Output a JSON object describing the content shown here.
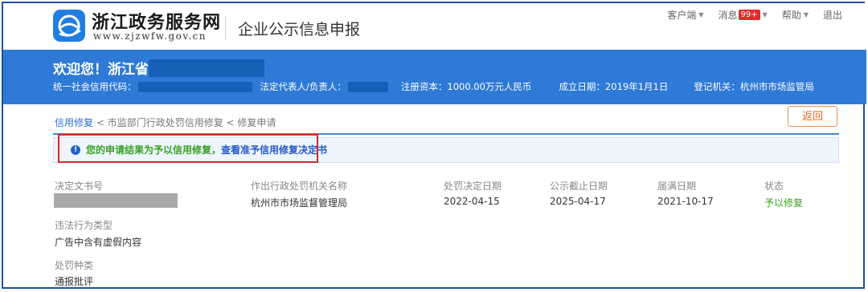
{
  "header": {
    "logo_title": "浙江政务服务网",
    "logo_url": "www.zjzwfw.gov.cn",
    "system_title": "企业公示信息申报",
    "nav": {
      "client": "客户端",
      "messages": "消息",
      "messages_badge": "99+",
      "help": "帮助",
      "logout": "退出"
    }
  },
  "banner": {
    "welcome": "欢迎您！浙江省",
    "credit_code_label": "统一社会信用代码：",
    "legal_rep_label": "法定代表人/负责人：",
    "registered_capital": "注册资本：1000.00万元人民币",
    "established": "成立日期：2019年1月1日",
    "authority": "登记机关：杭州市市场监管局"
  },
  "breadcrumb": {
    "item1": "信用修复",
    "sep1": " < ",
    "item2": "市监部门行政处罚信用修复",
    "sep2": " < ",
    "item3": "修复申请"
  },
  "back_button": "返回",
  "notice": {
    "text": "您的申请结果为予以信用修复，",
    "link": "查看准予信用修复决定书"
  },
  "details": {
    "labels": {
      "doc_no": "决定文书号",
      "authority": "作出行政处罚机关名称",
      "decision_date": "处罚决定日期",
      "publicity_end": "公示截止日期",
      "expiry": "届满日期",
      "status": "状态",
      "violation_type": "违法行为类型",
      "penalty_type": "处罚种类"
    },
    "values": {
      "authority": "杭州市市场监督管理局",
      "decision_date": "2022-04-15",
      "publicity_end": "2025-04-17",
      "expiry": "2021-10-17",
      "status": "予以修复",
      "violation_type": "广告中含有虚假内容",
      "penalty_type": "通报批评"
    }
  },
  "colors": {
    "banner": "#2e7ad6",
    "accent_orange": "#e5652a",
    "status_green": "#3ba21f",
    "highlight_red": "#d9262b"
  }
}
